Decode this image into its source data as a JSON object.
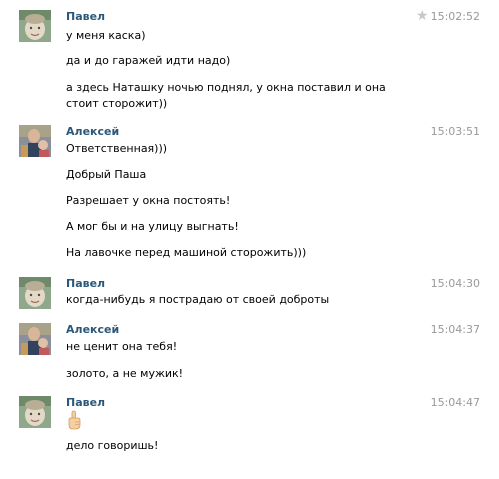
{
  "messages": [
    {
      "author": "Павел",
      "time": "15:02:52",
      "avatar": "child-photo",
      "starred": true,
      "lines": [
        "у меня каска)",
        "да и до гаражей идти надо)",
        "а здесь Наташку ночью поднял, у окна поставил и она стоит сторожит))"
      ]
    },
    {
      "author": "Алексей",
      "time": "15:03:51",
      "avatar": "man-with-child-photo",
      "lines": [
        "Ответственная)))",
        "Добрый Паша",
        "Разрешает у окна постоять!",
        "А мог бы и на улицу выгнать!",
        "На лавочке перед машиной сторожить)))"
      ]
    },
    {
      "author": "Павел",
      "time": "15:04:30",
      "avatar": "child-photo",
      "lines": [
        "когда-нибудь я пострадаю от своей доброты"
      ]
    },
    {
      "author": "Алексей",
      "time": "15:04:37",
      "avatar": "man-with-child-photo",
      "lines": [
        "не ценит она тебя!",
        "золото, а не мужик!"
      ]
    },
    {
      "author": "Павел",
      "time": "15:04:47",
      "avatar": "child-photo",
      "emoji": "pointing-up-emoji",
      "lines": [
        "дело говоришь!"
      ]
    }
  ],
  "colors": {
    "author": "#2b587a",
    "time": "#999999",
    "text": "#000000",
    "star": "#c8c8c8"
  }
}
